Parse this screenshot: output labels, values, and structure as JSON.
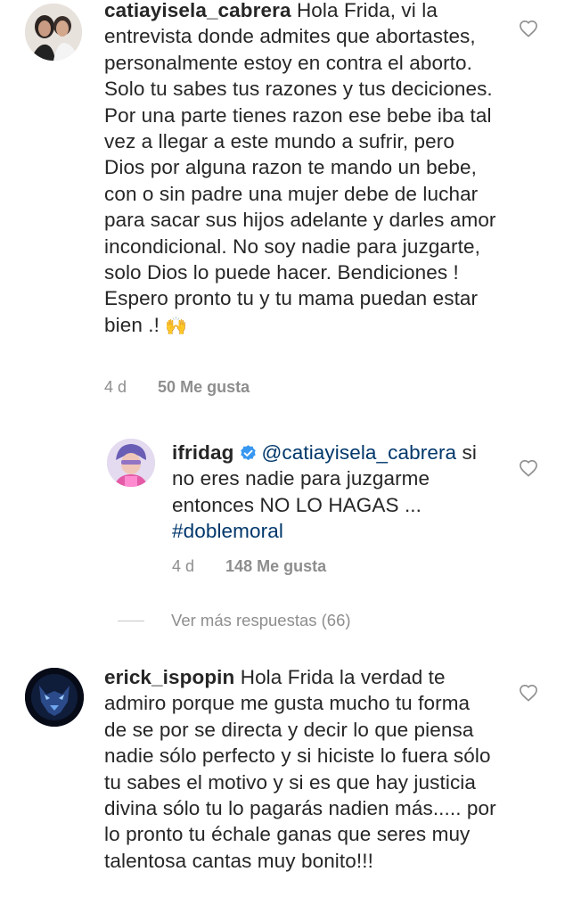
{
  "comments": [
    {
      "username": "catiayisela_cabrera",
      "text": "Hola Frida, vi la entrevista donde admites que abortastes, personalmente estoy en contra el aborto. Solo tu sabes tus razones y tus deciciones. Por una parte tienes razon ese bebe iba tal vez a llegar a este mundo a sufrir, pero Dios por alguna razon te mando un bebe, con o sin padre una mujer debe de luchar para sacar sus hijos adelante y darles amor incondicional. No soy nadie para juzgarte, solo Dios lo puede hacer. Bendiciones ! Espero pronto tu y tu mama puedan estar bien .! ",
      "emoji": "🙌",
      "time": "4 d",
      "likes": "50 Me gusta"
    },
    {
      "username": "ifridag",
      "verified": true,
      "mention": "@catiayisela_cabrera",
      "text": "si no eres nadie para juzgarme entonces NO LO HAGAS ...",
      "hashtag": "#doblemoral",
      "time": "4 d",
      "likes": "148 Me gusta"
    },
    {
      "username": "erick_ispopin",
      "text": "Hola Frida la verdad te admiro porque me gusta mucho tu forma de se por se directa y decir lo que piensa nadie sólo perfecto y si hiciste lo fuera sólo tu sabes el motivo y si es que hay justicia divina sólo tu lo pagarás nadien más..... por lo pronto tu échale ganas que seres muy talentosa cantas muy bonito!!!"
    }
  ],
  "view_more": "Ver más respuestas (66)",
  "icons": {
    "like": "heart-outline-icon",
    "verified": "verified-badge-icon"
  },
  "colors": {
    "text": "#262626",
    "meta": "#8e8e8e",
    "link": "#00376b",
    "verified": "#3897f0"
  }
}
